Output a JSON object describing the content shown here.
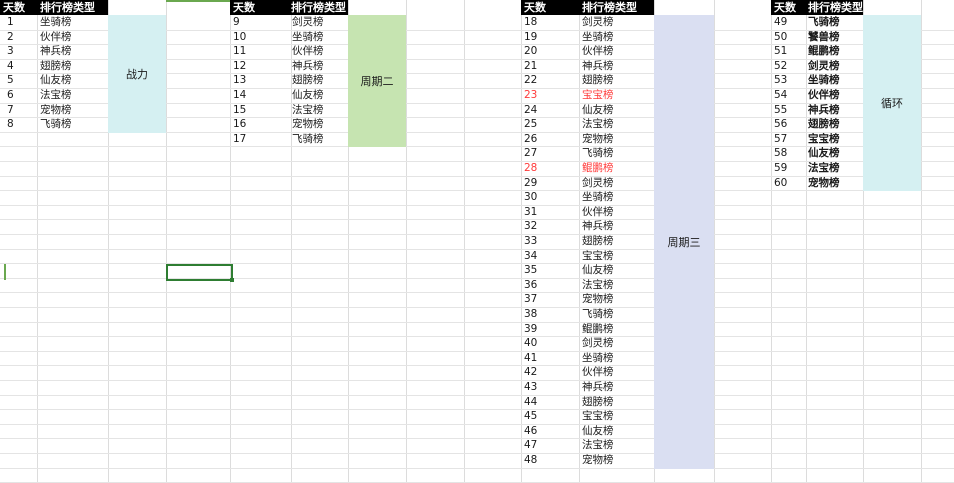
{
  "headers": {
    "day": "天数",
    "rank_type": "排行榜类型"
  },
  "sections": [
    {
      "label": "战力",
      "color": "#d5f0f2",
      "rows": [
        {
          "day": "1",
          "name": "坐骑榜"
        },
        {
          "day": "2",
          "name": "伙伴榜"
        },
        {
          "day": "3",
          "name": "神兵榜"
        },
        {
          "day": "4",
          "name": "翅膀榜"
        },
        {
          "day": "5",
          "name": "仙友榜"
        },
        {
          "day": "6",
          "name": "法宝榜"
        },
        {
          "day": "7",
          "name": "宠物榜"
        },
        {
          "day": "8",
          "name": "飞骑榜"
        }
      ]
    },
    {
      "label": "周期二",
      "color": "#c6e4b1",
      "rows": [
        {
          "day": "9",
          "name": "剑灵榜"
        },
        {
          "day": "10",
          "name": "坐骑榜"
        },
        {
          "day": "11",
          "name": "伙伴榜"
        },
        {
          "day": "12",
          "name": "神兵榜"
        },
        {
          "day": "13",
          "name": "翅膀榜"
        },
        {
          "day": "14",
          "name": "仙友榜"
        },
        {
          "day": "15",
          "name": "法宝榜"
        },
        {
          "day": "16",
          "name": "宠物榜"
        },
        {
          "day": "17",
          "name": "飞骑榜"
        }
      ]
    },
    {
      "label": "周期三",
      "color": "#dadff2",
      "rows": [
        {
          "day": "18",
          "name": "剑灵榜"
        },
        {
          "day": "19",
          "name": "坐骑榜"
        },
        {
          "day": "20",
          "name": "伙伴榜"
        },
        {
          "day": "21",
          "name": "神兵榜"
        },
        {
          "day": "22",
          "name": "翅膀榜"
        },
        {
          "day": "23",
          "name": "宝宝榜",
          "highlight": true
        },
        {
          "day": "24",
          "name": "仙友榜"
        },
        {
          "day": "25",
          "name": "法宝榜"
        },
        {
          "day": "26",
          "name": "宠物榜"
        },
        {
          "day": "27",
          "name": "飞骑榜"
        },
        {
          "day": "28",
          "name": "鲲鹏榜",
          "highlight": true
        },
        {
          "day": "29",
          "name": "剑灵榜"
        },
        {
          "day": "30",
          "name": "坐骑榜"
        },
        {
          "day": "31",
          "name": "伙伴榜"
        },
        {
          "day": "32",
          "name": "神兵榜"
        },
        {
          "day": "33",
          "name": "翅膀榜"
        },
        {
          "day": "34",
          "name": "宝宝榜"
        },
        {
          "day": "35",
          "name": "仙友榜"
        },
        {
          "day": "36",
          "name": "法宝榜"
        },
        {
          "day": "37",
          "name": "宠物榜"
        },
        {
          "day": "38",
          "name": "飞骑榜"
        },
        {
          "day": "39",
          "name": "鲲鹏榜"
        },
        {
          "day": "40",
          "name": "剑灵榜"
        },
        {
          "day": "41",
          "name": "坐骑榜"
        },
        {
          "day": "42",
          "name": "伙伴榜"
        },
        {
          "day": "43",
          "name": "神兵榜"
        },
        {
          "day": "44",
          "name": "翅膀榜"
        },
        {
          "day": "45",
          "name": "宝宝榜"
        },
        {
          "day": "46",
          "name": "仙友榜"
        },
        {
          "day": "47",
          "name": "法宝榜"
        },
        {
          "day": "48",
          "name": "宠物榜"
        }
      ]
    },
    {
      "label": "循环",
      "color": "#d5f0f2",
      "bold": true,
      "rows": [
        {
          "day": "49",
          "name": "飞骑榜"
        },
        {
          "day": "50",
          "name": "饕兽榜"
        },
        {
          "day": "51",
          "name": "鲲鹏榜"
        },
        {
          "day": "52",
          "name": "剑灵榜"
        },
        {
          "day": "53",
          "name": "坐骑榜"
        },
        {
          "day": "54",
          "name": "伙伴榜"
        },
        {
          "day": "55",
          "name": "神兵榜"
        },
        {
          "day": "56",
          "name": "翅膀榜"
        },
        {
          "day": "57",
          "name": "宝宝榜"
        },
        {
          "day": "58",
          "name": "仙友榜"
        },
        {
          "day": "59",
          "name": "法宝榜"
        },
        {
          "day": "60",
          "name": "宠物榜"
        }
      ]
    }
  ],
  "colors": {
    "header_bg": "#000000",
    "header_text": "#ffffff",
    "highlight_text": "#ff3b3b",
    "selection": "#2e7d32"
  }
}
